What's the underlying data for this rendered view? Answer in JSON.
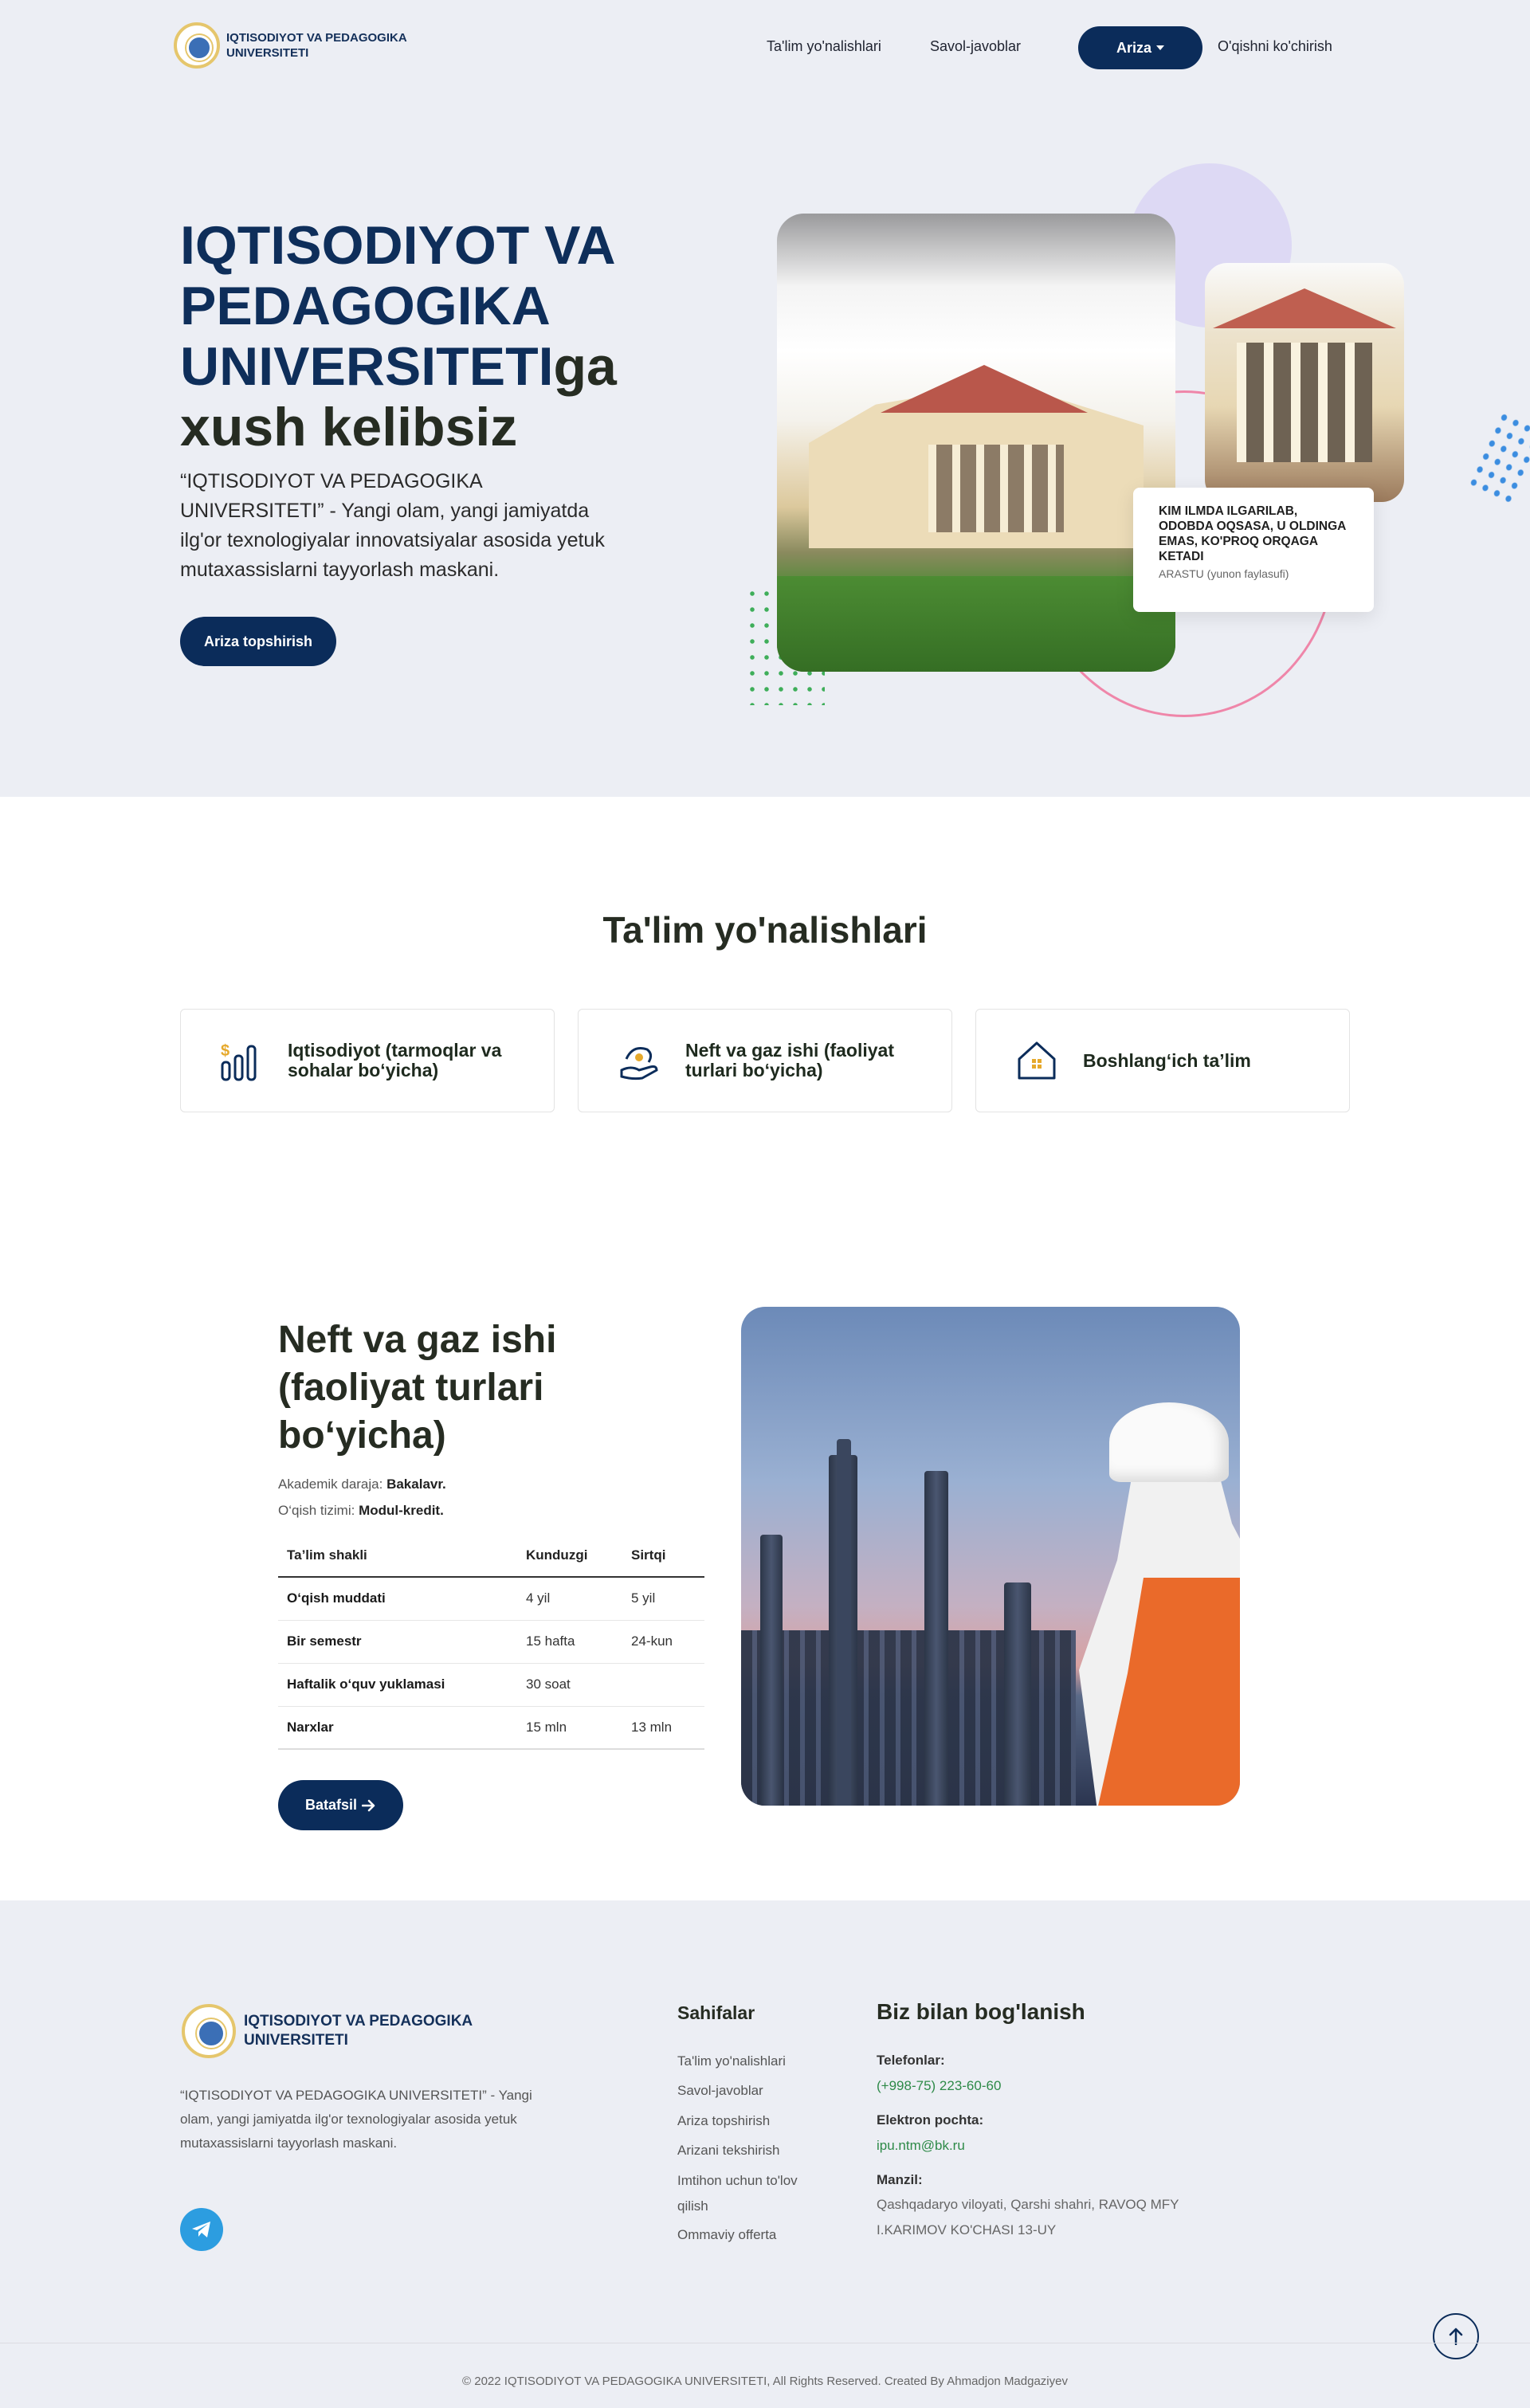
{
  "header": {
    "logo_text": "IQTISODIYOT VA PEDAGOGIKA UNIVERSITETI",
    "nav": [
      "Ta'lim yo'nalishlari",
      "Savol-javoblar"
    ],
    "ariza_label": "Ariza",
    "transfer_label": "O'qishni ko'chirish"
  },
  "hero": {
    "title_blue": "IQTISODIYOT VA PEDAGOGIKA UNIVERSITETI",
    "title_suffix": "ga",
    "title_dark": "xush kelibsiz",
    "description": "“IQTISODIYOT VA PEDAGOGIKA UNIVERSITETI” - Yangi olam, yangi jamiyatda ilg'or texnologiyalar innovatsiyalar asosida yetuk mutaxassislarni tayyorlash maskani.",
    "button": "Ariza topshirish",
    "quote": {
      "text": "KIM ILMDA ILGARILAB, ODOBDA OQSASA, U OLDINGA EMAS, KO'PROQ ORQAGA KETADI",
      "author": "ARASTU (yunon faylasufi)"
    }
  },
  "directions": {
    "title": "Ta'lim yo'nalishlari",
    "items": [
      {
        "label": "Iqtisodiyot (tarmoqlar va sohalar bo‘yicha)",
        "icon": "chart-coin-icon"
      },
      {
        "label": "Neft va gaz ishi (faoliyat turlari bo‘yicha)",
        "icon": "hand-money-icon"
      },
      {
        "label": "Boshlang‘ich ta’lim",
        "icon": "house-icon"
      }
    ]
  },
  "program": {
    "title": "Neft va gaz ishi (faoliyat turlari bo‘yicha)",
    "degree_label": "Akademik daraja:",
    "degree_value": "Bakalavr.",
    "system_label": "O‘qish tizimi:",
    "system_value": "Modul-kredit.",
    "table": {
      "headers": [
        "Ta’lim shakli",
        "Kunduzgi",
        "Sirtqi"
      ],
      "rows": [
        [
          "O‘qish muddati",
          "4 yil",
          "5 yil"
        ],
        [
          "Bir semestr",
          "15 hafta",
          "24-kun"
        ],
        [
          "Haftalik o‘quv yuklamasi",
          "30 soat",
          ""
        ],
        [
          "Narxlar",
          "15 mln",
          "13 mln"
        ]
      ]
    },
    "button": "Batafsil"
  },
  "footer": {
    "logo_text": "IQTISODIYOT VA PEDAGOGIKA UNIVERSITETI",
    "description": "“IQTISODIYOT VA PEDAGOGIKA UNIVERSITETI” - Yangi olam, yangi jamiyatda ilg'or texnologiyalar asosida yetuk mutaxassislarni tayyorlash maskani.",
    "pages_title": "Sahifalar",
    "pages": [
      "Ta'lim yo'nalishlari",
      "Savol-javoblar",
      "Ariza topshirish",
      "Arizani tekshirish",
      "Imtihon uchun to'lov qilish",
      "Ommaviy offerta"
    ],
    "contact_title": "Biz bilan bog'lanish",
    "phone_label": "Telefonlar:",
    "phone": "(+998-75) 223-60-60",
    "email_label": "Elektron pochta:",
    "email": "ipu.ntm@bk.ru",
    "address_label": "Manzil:",
    "address": "Qashqadaryo viloyati, Qarshi shahri, RAVOQ MFY I.KARIMOV KO'CHASI 13-UY",
    "copyright": "© 2022 IQTISODIYOT VA PEDAGOGIKA UNIVERSITETI, All Rights Reserved. Created By Ahmadjon Madgaziyev"
  },
  "colors": {
    "primary": "#0b2c5a",
    "section_bg": "#eceef4",
    "accent_green": "#2e8a48",
    "accent_pink": "#ef86a9"
  }
}
